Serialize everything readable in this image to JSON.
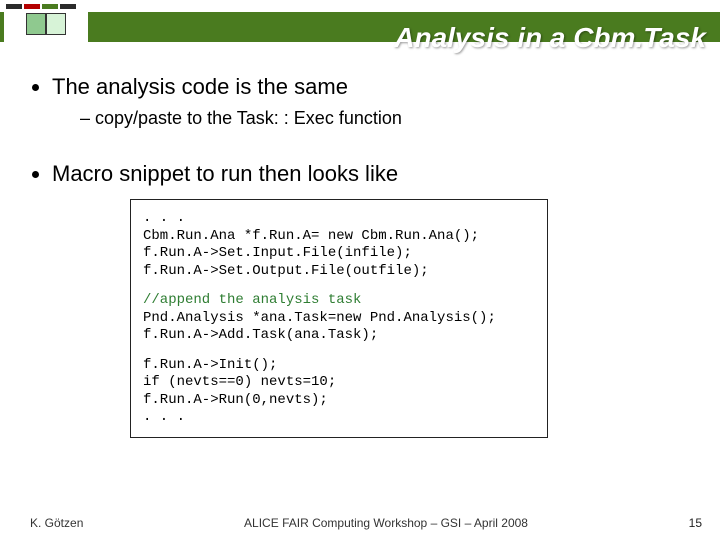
{
  "header": {
    "title": "Analysis in a Cbm.Task"
  },
  "bullets": {
    "b1": "The analysis code is the same",
    "b1_sub": "copy/paste to the Task: : Exec function",
    "b2": "Macro snippet to run then looks like"
  },
  "code": {
    "block1": {
      "l1": ". . .",
      "l2": "Cbm.Run.Ana *f.Run.A= new Cbm.Run.Ana();",
      "l3": "f.Run.A->Set.Input.File(infile);",
      "l4": "f.Run.A->Set.Output.File(outfile);"
    },
    "block2": {
      "c1": "//append the analysis task",
      "l1": "Pnd.Analysis *ana.Task=new Pnd.Analysis();",
      "l2": "f.Run.A->Add.Task(ana.Task);"
    },
    "block3": {
      "l1": "f.Run.A->Init();",
      "l2": "if (nevts==0) nevts=10;",
      "l3": "f.Run.A->Run(0,nevts);",
      "l4": ". . ."
    }
  },
  "footer": {
    "author": "K. Götzen",
    "venue": "ALICE FAIR Computing Workshop – GSI – April 2008",
    "page": "15"
  }
}
